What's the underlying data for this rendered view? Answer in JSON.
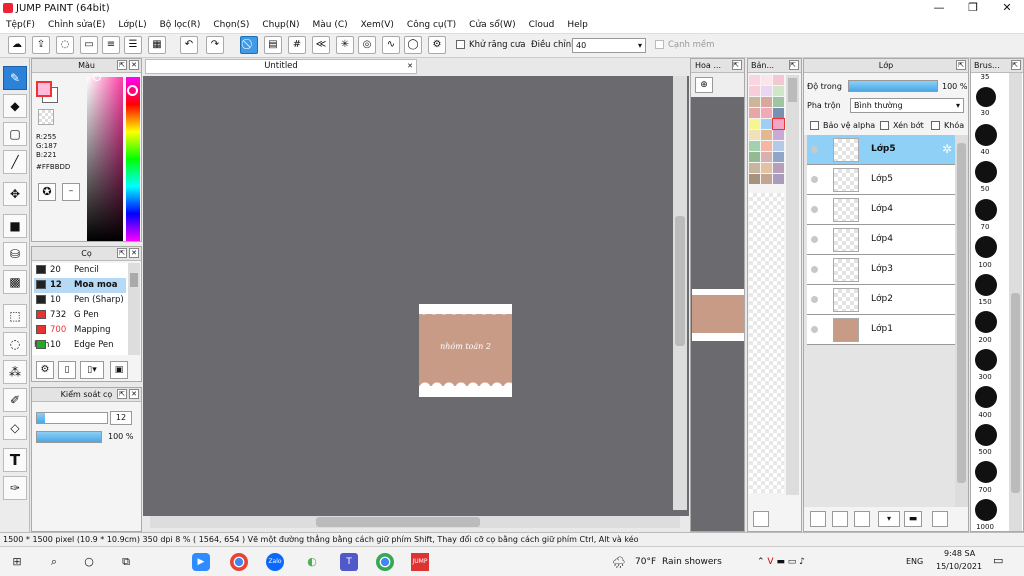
{
  "app": {
    "title": "JUMP PAINT (64bit)"
  },
  "menu": [
    "Tệp(F)",
    "Chỉnh sửa(E)",
    "Lớp(L)",
    "Bộ lọc(R)",
    "Chọn(S)",
    "Chụp(N)",
    "Màu (C)",
    "Xem(V)",
    "Công cụ(T)",
    "Cửa sổ(W)",
    "Cloud",
    "Help"
  ],
  "toolbar": {
    "antialias_label": "Khử răng cưa",
    "adjust_label": "Điều chỉnh",
    "adjust_value": "40",
    "edge_label": "Cạnh mềm"
  },
  "color_panel": {
    "title": "Màu",
    "r": "R:255",
    "g": "G:187",
    "b": "B:221",
    "hex": "#FFBBDD",
    "fg": "#ffbbdd"
  },
  "brush_panel": {
    "title": "Cọ",
    "items": [
      {
        "size": "20",
        "name": "Pencil",
        "color": "#222222"
      },
      {
        "size": "12",
        "name": "Moa moa",
        "color": "#222222"
      },
      {
        "size": "10",
        "name": "Pen (Sharp)",
        "color": "#222222"
      },
      {
        "size": "732",
        "name": "G Pen",
        "color": "#e53333"
      },
      {
        "size": "700",
        "name": "Mapping Pen",
        "color": "#e53333"
      },
      {
        "size": "10",
        "name": "Edge Pen",
        "color": "#22aa22"
      }
    ]
  },
  "brush_control": {
    "title": "Kiểm soát cọ",
    "size": "12",
    "opacity": "100 %"
  },
  "canvas": {
    "tab": "Untitled",
    "art_text": "nhóm toán 2"
  },
  "nav": {
    "title": "Hoa ..."
  },
  "palette": {
    "title": "Bản..."
  },
  "layer_panel": {
    "title": "Lớp",
    "opacity_label": "Độ trong",
    "opacity_value": "100 %",
    "blend_label": "Pha trộn",
    "blend_value": "Bình thường",
    "protect_alpha": "Bảo vệ alpha",
    "clip": "Xén bớt",
    "lock": "Khóa",
    "layers": [
      "Lớp5",
      "Lớp5",
      "Lớp4",
      "Lớp4",
      "Lớp3",
      "Lớp2",
      "Lớp1"
    ]
  },
  "brush_size_panel": {
    "title": "Brus...",
    "sizes": [
      "35",
      "30",
      "40",
      "50",
      "70",
      "100",
      "150",
      "200",
      "300",
      "400",
      "500",
      "700",
      "1000"
    ]
  },
  "status": {
    "text": "1500 * 1500 pixel   (10.9 * 10.9cm)   350 dpi   8 %   ( 1564, 654 )   Vẽ một đường thẳng bằng cách giữ phím Shift, Thay đổi cỡ cọ bằng cách giữ phím Ctrl, Alt và kéo"
  },
  "taskbar": {
    "weather_temp": "70°F",
    "weather_text": "Rain showers",
    "lang": "ENG",
    "time": "9:48 SA",
    "date": "15/10/2021"
  }
}
